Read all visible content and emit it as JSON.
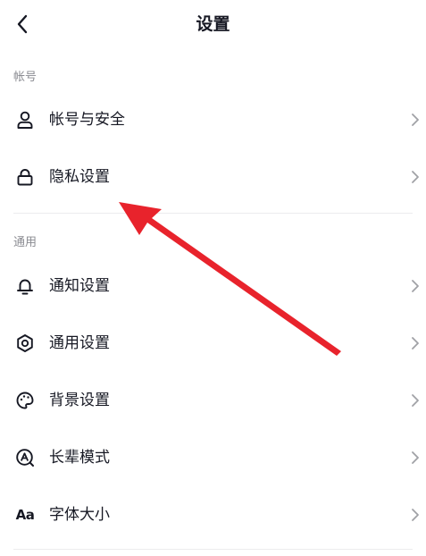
{
  "header": {
    "title": "设置",
    "back_icon": "chevron-left-icon"
  },
  "sections": [
    {
      "label": "帐号",
      "items": [
        {
          "label": "帐号与安全",
          "icon": "user-icon"
        },
        {
          "label": "隐私设置",
          "icon": "lock-icon"
        }
      ]
    },
    {
      "label": "通用",
      "items": [
        {
          "label": "通知设置",
          "icon": "bell-icon"
        },
        {
          "label": "通用设置",
          "icon": "gear-icon"
        },
        {
          "label": "背景设置",
          "icon": "palette-icon"
        },
        {
          "label": "长辈模式",
          "icon": "elder-mode-icon"
        },
        {
          "label": "字体大小",
          "icon": "font-size-icon",
          "icon_text": "Aa"
        }
      ]
    }
  ],
  "colors": {
    "text": "#161823",
    "secondary_text": "#8a8b91",
    "chevron": "#a0a1a6",
    "divider": "#ececee",
    "annotation_arrow": "#e8232c"
  }
}
